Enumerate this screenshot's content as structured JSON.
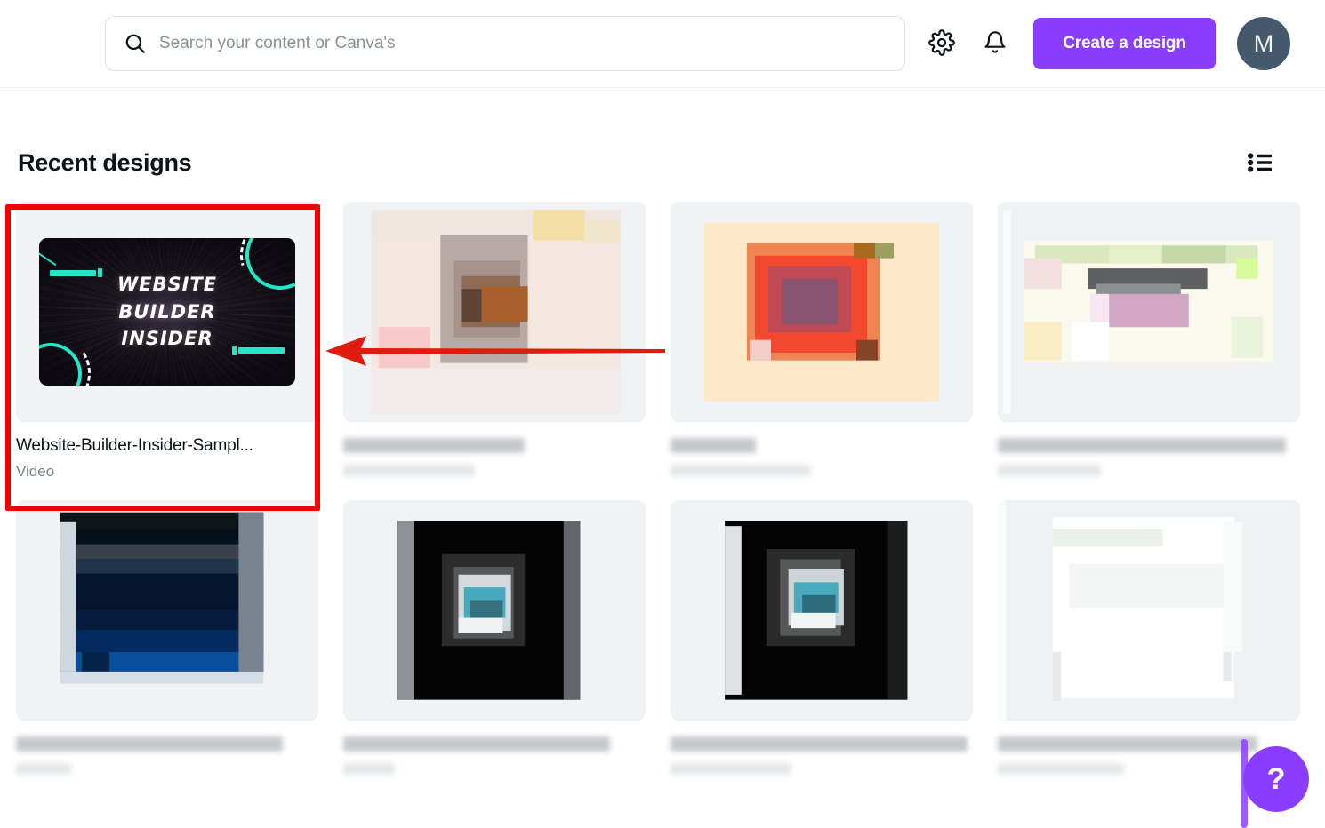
{
  "header": {
    "search": {
      "placeholder": "Search your content or Canva's",
      "value": "",
      "icon": "search-icon"
    },
    "settings_icon": "gear-icon",
    "notifications_icon": "bell-icon",
    "create_design_label": "Create a design",
    "avatar_initial": "M",
    "avatar_color": "#44596b",
    "brand_purple": "#8b3dff"
  },
  "main": {
    "section_title": "Recent designs",
    "view_toggle_icon": "list-view-icon"
  },
  "designs": [
    {
      "title": "Website-Builder-Insider-Sampl...",
      "subtitle": "Video",
      "selected": true,
      "thumb_kind": "website-builder-insider",
      "thumb_text_lines": [
        "WEBSITE",
        "BUILDER",
        "INSIDER"
      ],
      "thumb_accent": "#21e6c8",
      "thumb_background": "#140f1a"
    },
    {
      "title": "",
      "subtitle": "",
      "selected": false,
      "thumb_kind": "blurred-beige-pink"
    },
    {
      "title": "",
      "subtitle": "",
      "selected": false,
      "thumb_kind": "blurred-orange-cream"
    },
    {
      "title": "",
      "subtitle": "",
      "selected": false,
      "thumb_kind": "blurred-green-pink"
    },
    {
      "title": "",
      "subtitle": "",
      "selected": false,
      "thumb_kind": "blurred-navy-blue"
    },
    {
      "title": "",
      "subtitle": "",
      "selected": false,
      "thumb_kind": "blurred-black-teal-circle"
    },
    {
      "title": "",
      "subtitle": "",
      "selected": false,
      "thumb_kind": "blurred-black-teal-circle"
    },
    {
      "title": "",
      "subtitle": "",
      "selected": false,
      "thumb_kind": "blurred-white-light"
    }
  ],
  "annotations": {
    "highlight_color": "#f40000",
    "box_target": "Website-Builder-Insider-Sampl...",
    "arrow_direction": "left"
  },
  "overlay": {
    "help_label": "?",
    "help_color": "#8b3dff",
    "scrollbar_color": "#8b3dff"
  }
}
